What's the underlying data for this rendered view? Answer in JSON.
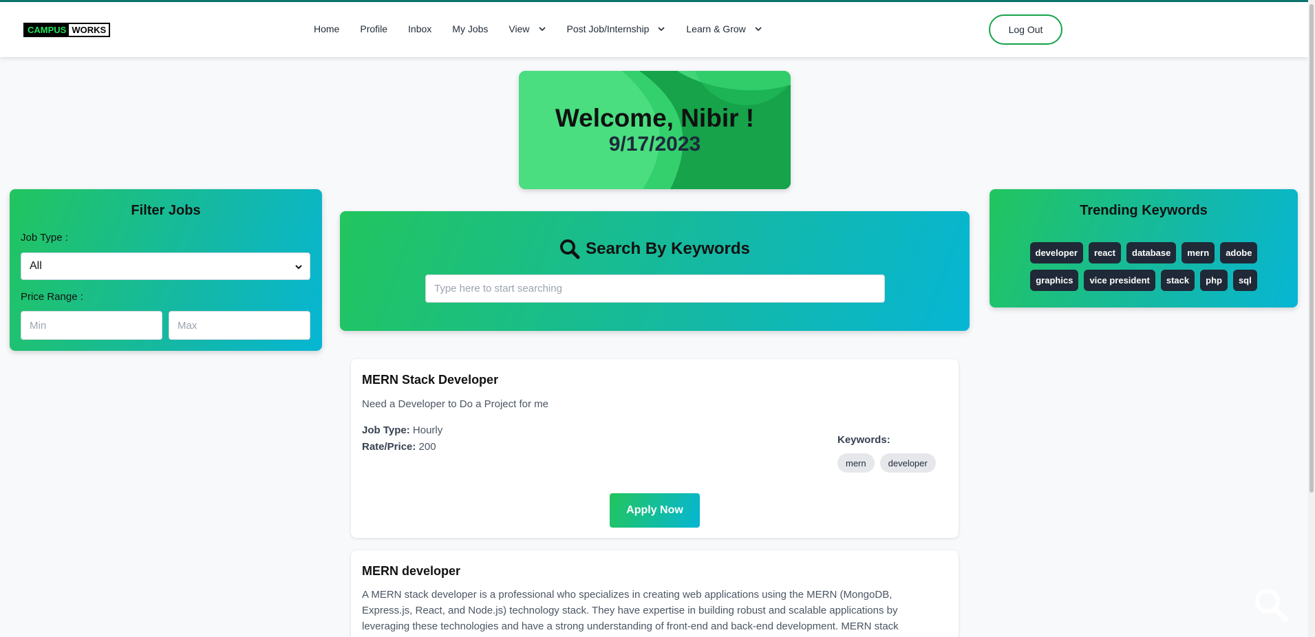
{
  "nav": {
    "logo_part1": "CAMPUS",
    "logo_part2": "WORKS",
    "items": [
      {
        "label": "Home"
      },
      {
        "label": "Profile"
      },
      {
        "label": "Inbox"
      },
      {
        "label": "My Jobs"
      },
      {
        "label": "View"
      },
      {
        "label": "Post Job/Internship"
      },
      {
        "label": "Learn & Grow"
      }
    ],
    "logout_label": "Log Out"
  },
  "welcome": {
    "title": "Welcome, Nibir !",
    "date": "9/17/2023"
  },
  "filter": {
    "title": "Filter Jobs",
    "job_type_label": "Job Type :",
    "job_type_value": "All",
    "price_label": "Price Range :",
    "min_placeholder": "Min",
    "max_placeholder": "Max"
  },
  "search": {
    "title": "Search By Keywords",
    "placeholder": "Type here to start searching"
  },
  "trending": {
    "title": "Trending Keywords",
    "row1": [
      "developer",
      "react",
      "database",
      "mern",
      "adobe"
    ],
    "row2": [
      "graphics",
      "vice president",
      "stack",
      "php",
      "sql"
    ]
  },
  "jobs": [
    {
      "title": "MERN Stack Developer",
      "description": "Need a Developer to Do a Project for me",
      "job_type_label": "Job Type:",
      "job_type": "Hourly",
      "rate_label": "Rate/Price:",
      "rate": "200",
      "keywords_label": "Keywords:",
      "keywords": [
        "mern",
        "developer"
      ],
      "apply_label": "Apply Now"
    },
    {
      "title": "MERN developer",
      "description_lines": [
        "A MERN stack developer is a professional who specializes in creating web applications using the MERN (MongoDB,",
        "Express.js, React, and Node.js) technology stack. They have expertise in building robust and scalable applications by",
        "leveraging these technologies and have a strong understanding of front-end and back-end development. MERN stack"
      ]
    }
  ],
  "colors": {
    "accent_green": "#22c55e",
    "accent_cyan": "#06b6d4",
    "chip_dark": "#1f2937",
    "logout_border": "#16a34a"
  }
}
